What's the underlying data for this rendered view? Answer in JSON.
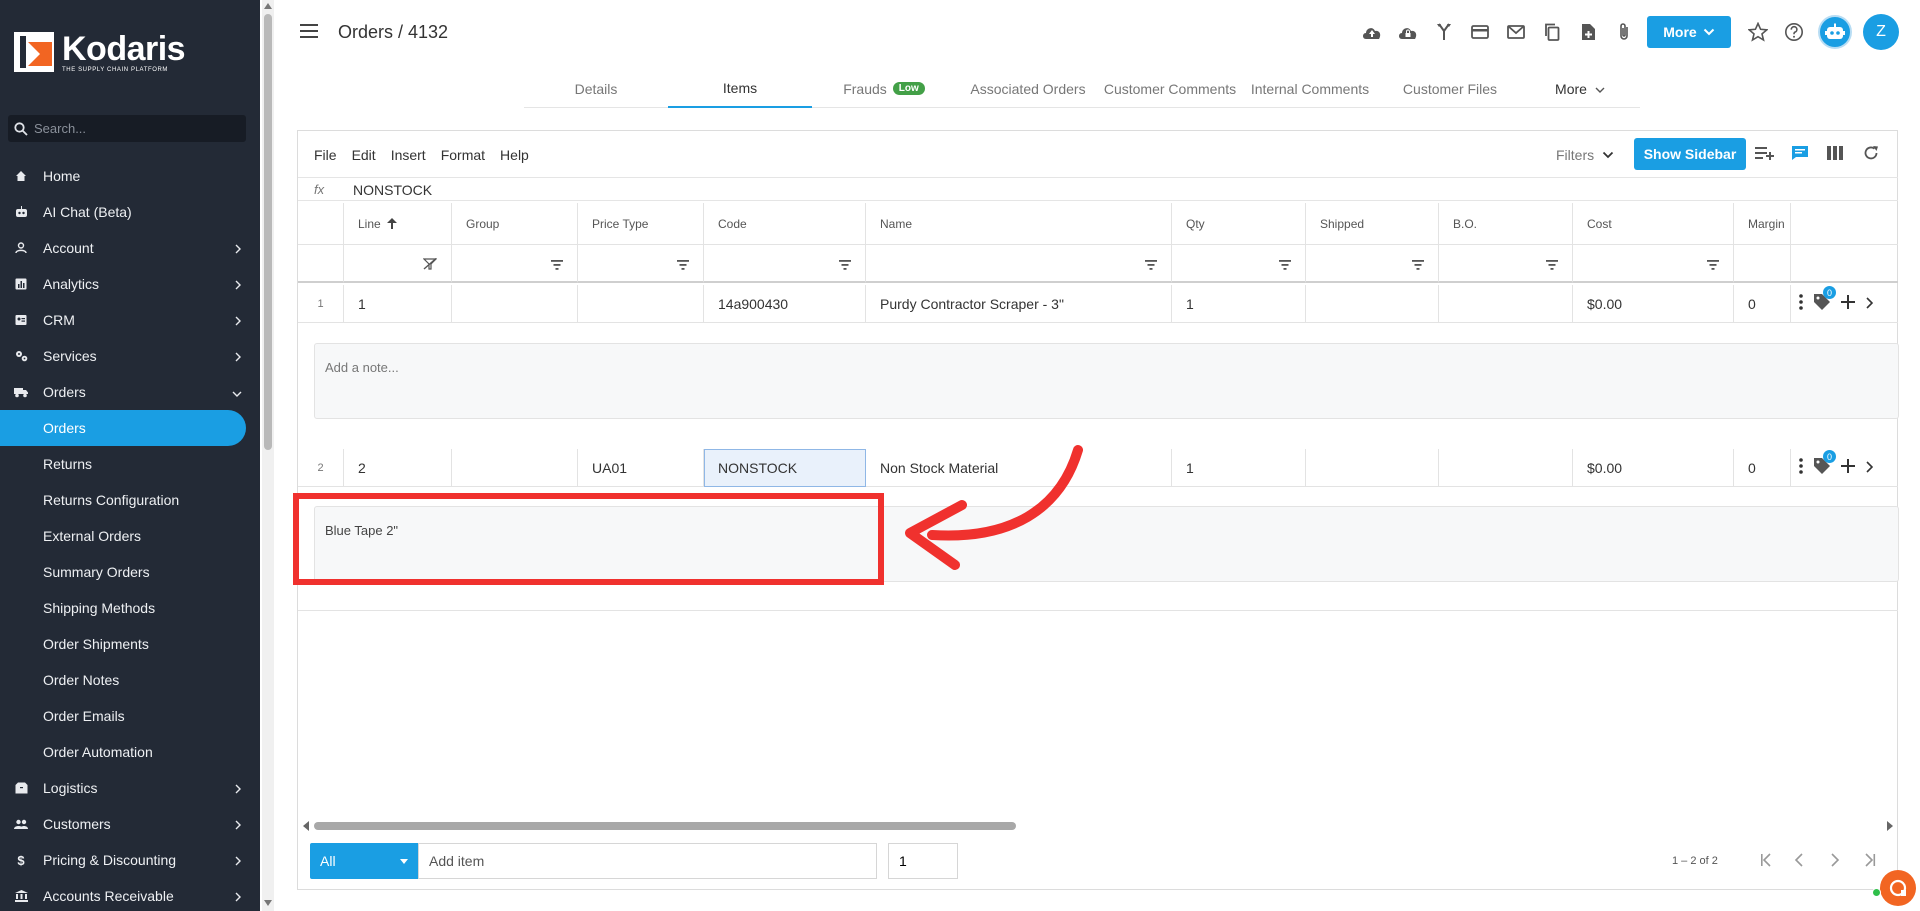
{
  "brand": {
    "name": "Kodaris",
    "tagline": "THE SUPPLY CHAIN PLATFORM",
    "accent": "#1a9ee3",
    "sidebar_bg": "#232a36",
    "logo_color": "#f26522"
  },
  "search": {
    "placeholder": "Search..."
  },
  "nav": {
    "home": "Home",
    "ai_chat": "AI Chat (Beta)",
    "account": "Account",
    "analytics": "Analytics",
    "crm": "CRM",
    "services": "Services",
    "orders": "Orders",
    "orders_sub": [
      "Orders",
      "Returns",
      "Returns Configuration",
      "External Orders",
      "Summary Orders",
      "Shipping Methods",
      "Order Shipments",
      "Order Notes",
      "Order Emails",
      "Order Automation"
    ],
    "logistics": "Logistics",
    "customers": "Customers",
    "pricing": "Pricing & Discounting",
    "ar": "Accounts Receivable"
  },
  "header": {
    "title": "Orders / 4132",
    "more_label": "More",
    "avatar_initial": "Z"
  },
  "tabs": {
    "details": "Details",
    "items": "Items",
    "frauds": "Frauds",
    "frauds_badge": "Low",
    "associated": "Associated Orders",
    "customer_comments": "Customer Comments",
    "internal_comments": "Internal Comments",
    "customer_files": "Customer Files",
    "more": "More"
  },
  "toolbar": {
    "file": "File",
    "edit": "Edit",
    "insert": "Insert",
    "format": "Format",
    "help": "Help",
    "filters": "Filters",
    "show_sidebar": "Show Sidebar"
  },
  "formula": {
    "fx": "fx",
    "value": "NONSTOCK"
  },
  "columns": {
    "line": "Line",
    "group": "Group",
    "price_type": "Price Type",
    "code": "Code",
    "name": "Name",
    "qty": "Qty",
    "shipped": "Shipped",
    "bo": "B.O.",
    "cost": "Cost",
    "margin": "Margin"
  },
  "rows": [
    {
      "num": "1",
      "line": "1",
      "group": "",
      "price_type": "",
      "code": "14a900430",
      "name": "Purdy Contractor Scraper - 3\"",
      "qty": "1",
      "shipped": "",
      "bo": "",
      "cost": "$0.00",
      "margin": "0",
      "tag_count": "0",
      "note_placeholder": "Add a note...",
      "note_value": ""
    },
    {
      "num": "2",
      "line": "2",
      "group": "",
      "price_type": "UA01",
      "code": "NONSTOCK",
      "name": "Non Stock Material",
      "qty": "1",
      "shipped": "",
      "bo": "",
      "cost": "$0.00",
      "margin": "0",
      "tag_count": "0",
      "note_placeholder": "",
      "note_value": "Blue Tape 2\""
    }
  ],
  "footer": {
    "filter_select": "All",
    "add_item_placeholder": "Add item",
    "qty_value": "1",
    "range": "1 – 2 of 2"
  },
  "annotation_color": "#f0312e"
}
